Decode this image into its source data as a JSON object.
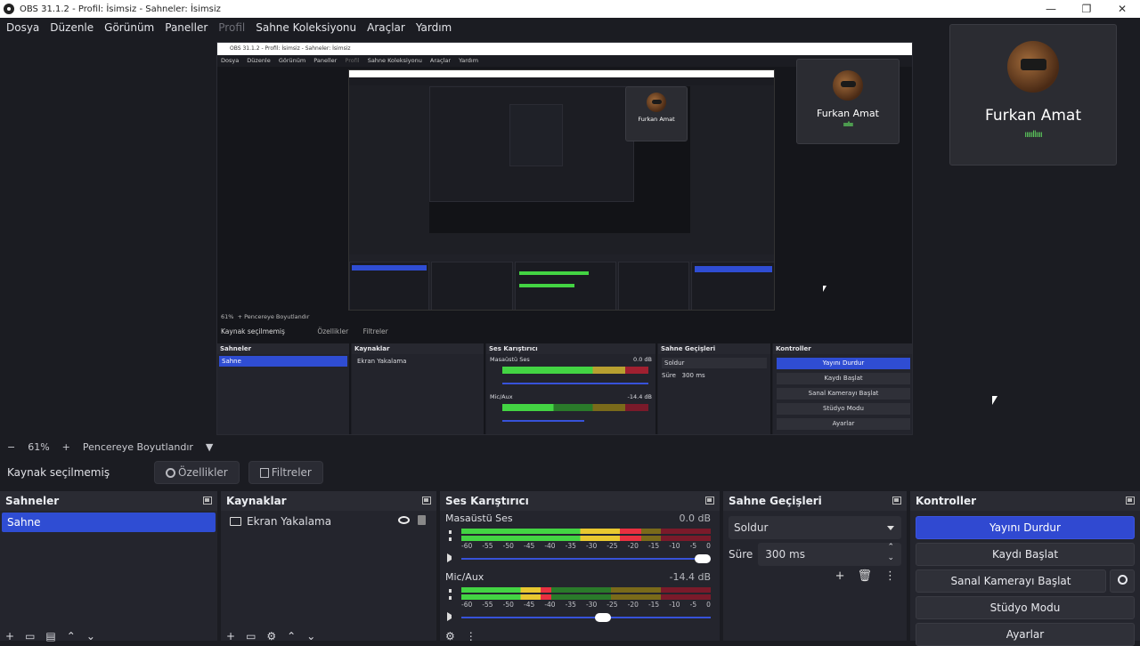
{
  "window": {
    "title": "OBS 31.1.2 - Profil: İsimsiz - Sahneler: İsimsiz",
    "minimize": "—",
    "maximize": "❐",
    "close": "✕"
  },
  "menu": [
    {
      "label": "Dosya",
      "enabled": true
    },
    {
      "label": "Düzenle",
      "enabled": true
    },
    {
      "label": "Görünüm",
      "enabled": true
    },
    {
      "label": "Paneller",
      "enabled": true
    },
    {
      "label": "Profil",
      "enabled": false
    },
    {
      "label": "Sahne Koleksiyonu",
      "enabled": true
    },
    {
      "label": "Araçlar",
      "enabled": true
    },
    {
      "label": "Yardım",
      "enabled": true
    }
  ],
  "webcam": {
    "name": "Furkan Amat",
    "level": "ıııııllıııı"
  },
  "nested": {
    "title": "OBS 31.1.2 - Profil: İsimsiz - Sahneler: İsimsiz",
    "zoom": "61%",
    "fit_label": "Pencereye Boyutlandır",
    "source_none": "Kaynak seçilmemiş",
    "properties": "Özellikler",
    "filters": "Filtreler"
  },
  "zoombar": {
    "minus": "−",
    "percent": "61%",
    "plus": "+",
    "fit_label": "Pencereye Boyutlandır",
    "arrow": "▼"
  },
  "source_bar": {
    "none_selected": "Kaynak seçilmemiş",
    "properties": "Özellikler",
    "filters": "Filtreler"
  },
  "scenes": {
    "title": "Sahneler",
    "items": [
      "Sahne"
    ]
  },
  "sources": {
    "title": "Kaynaklar",
    "items": [
      {
        "name": "Ekran Yakalama"
      }
    ]
  },
  "mixer": {
    "title": "Ses Karıştırıcı",
    "channels": [
      {
        "name": "Masaüstü Ses",
        "db": "0.0 dB",
        "level": 0.72,
        "volume": 1.0
      },
      {
        "name": "Mic/Aux",
        "db": "-14.4 dB",
        "level": 0.36,
        "volume": 0.6
      }
    ],
    "ticks": [
      "-60",
      "-55",
      "-50",
      "-45",
      "-40",
      "-35",
      "-30",
      "-25",
      "-20",
      "-15",
      "-10",
      "-5",
      "0"
    ]
  },
  "transitions": {
    "title": "Sahne Geçişleri",
    "selected": "Soldur",
    "duration_label": "Süre",
    "duration_value": "300 ms"
  },
  "controls": {
    "title": "Kontroller",
    "stop_stream": "Yayını Durdur",
    "start_record": "Kaydı Başlat",
    "virtual_cam": "Sanal Kamerayı Başlat",
    "studio_mode": "Stüdyo Modu",
    "settings": "Ayarlar"
  },
  "colors": {
    "accent": "#2f4dd3",
    "background": "#1b1c22",
    "panel": "#24252d",
    "meter_green": "#43d443",
    "meter_yellow": "#e8c830",
    "meter_red": "#e83040"
  },
  "icons": [
    "obs-logo-icon",
    "gear-icon",
    "filter-icon",
    "monitor-icon",
    "eye-icon",
    "lock-icon",
    "speaker-icon",
    "kebab-icon",
    "plus-icon",
    "trash-icon",
    "float-icon"
  ]
}
